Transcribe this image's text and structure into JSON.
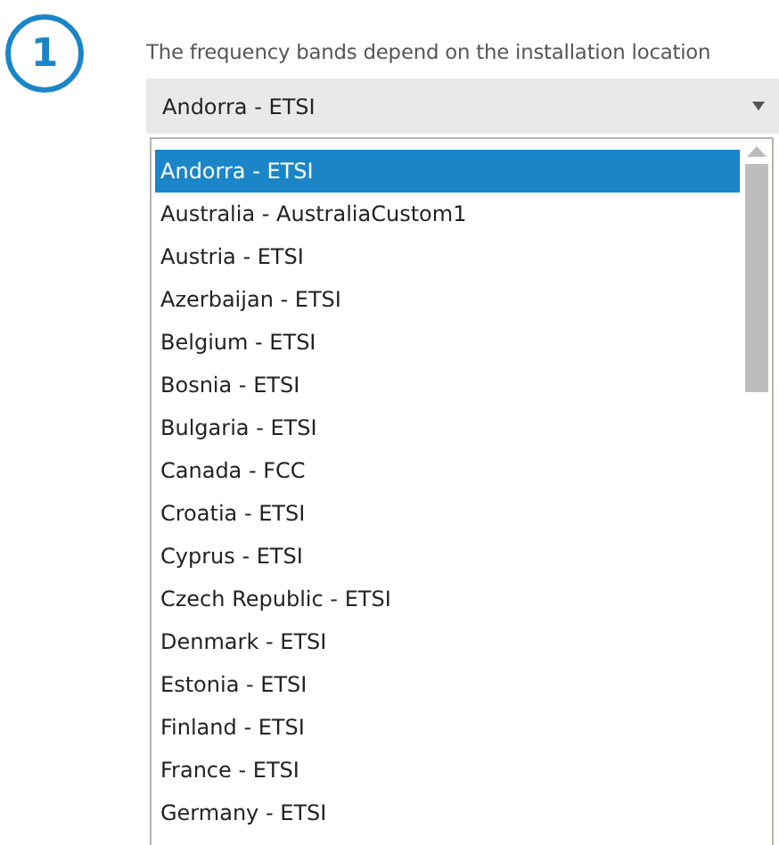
{
  "step_badge": "1",
  "instruction": "The frequency bands depend on the installation location",
  "dropdown": {
    "value": "Andorra - ETSI",
    "options": [
      {
        "label": "Andorra - ETSI",
        "selected": true
      },
      {
        "label": "Australia - AustraliaCustom1",
        "selected": false
      },
      {
        "label": "Austria - ETSI",
        "selected": false
      },
      {
        "label": "Azerbaijan - ETSI",
        "selected": false
      },
      {
        "label": "Belgium - ETSI",
        "selected": false
      },
      {
        "label": "Bosnia - ETSI",
        "selected": false
      },
      {
        "label": "Bulgaria - ETSI",
        "selected": false
      },
      {
        "label": "Canada - FCC",
        "selected": false
      },
      {
        "label": "Croatia - ETSI",
        "selected": false
      },
      {
        "label": "Cyprus - ETSI",
        "selected": false
      },
      {
        "label": "Czech Republic - ETSI",
        "selected": false
      },
      {
        "label": "Denmark - ETSI",
        "selected": false
      },
      {
        "label": "Estonia - ETSI",
        "selected": false
      },
      {
        "label": "Finland - ETSI",
        "selected": false
      },
      {
        "label": "France - ETSI",
        "selected": false
      },
      {
        "label": "Germany - ETSI",
        "selected": false
      }
    ]
  }
}
